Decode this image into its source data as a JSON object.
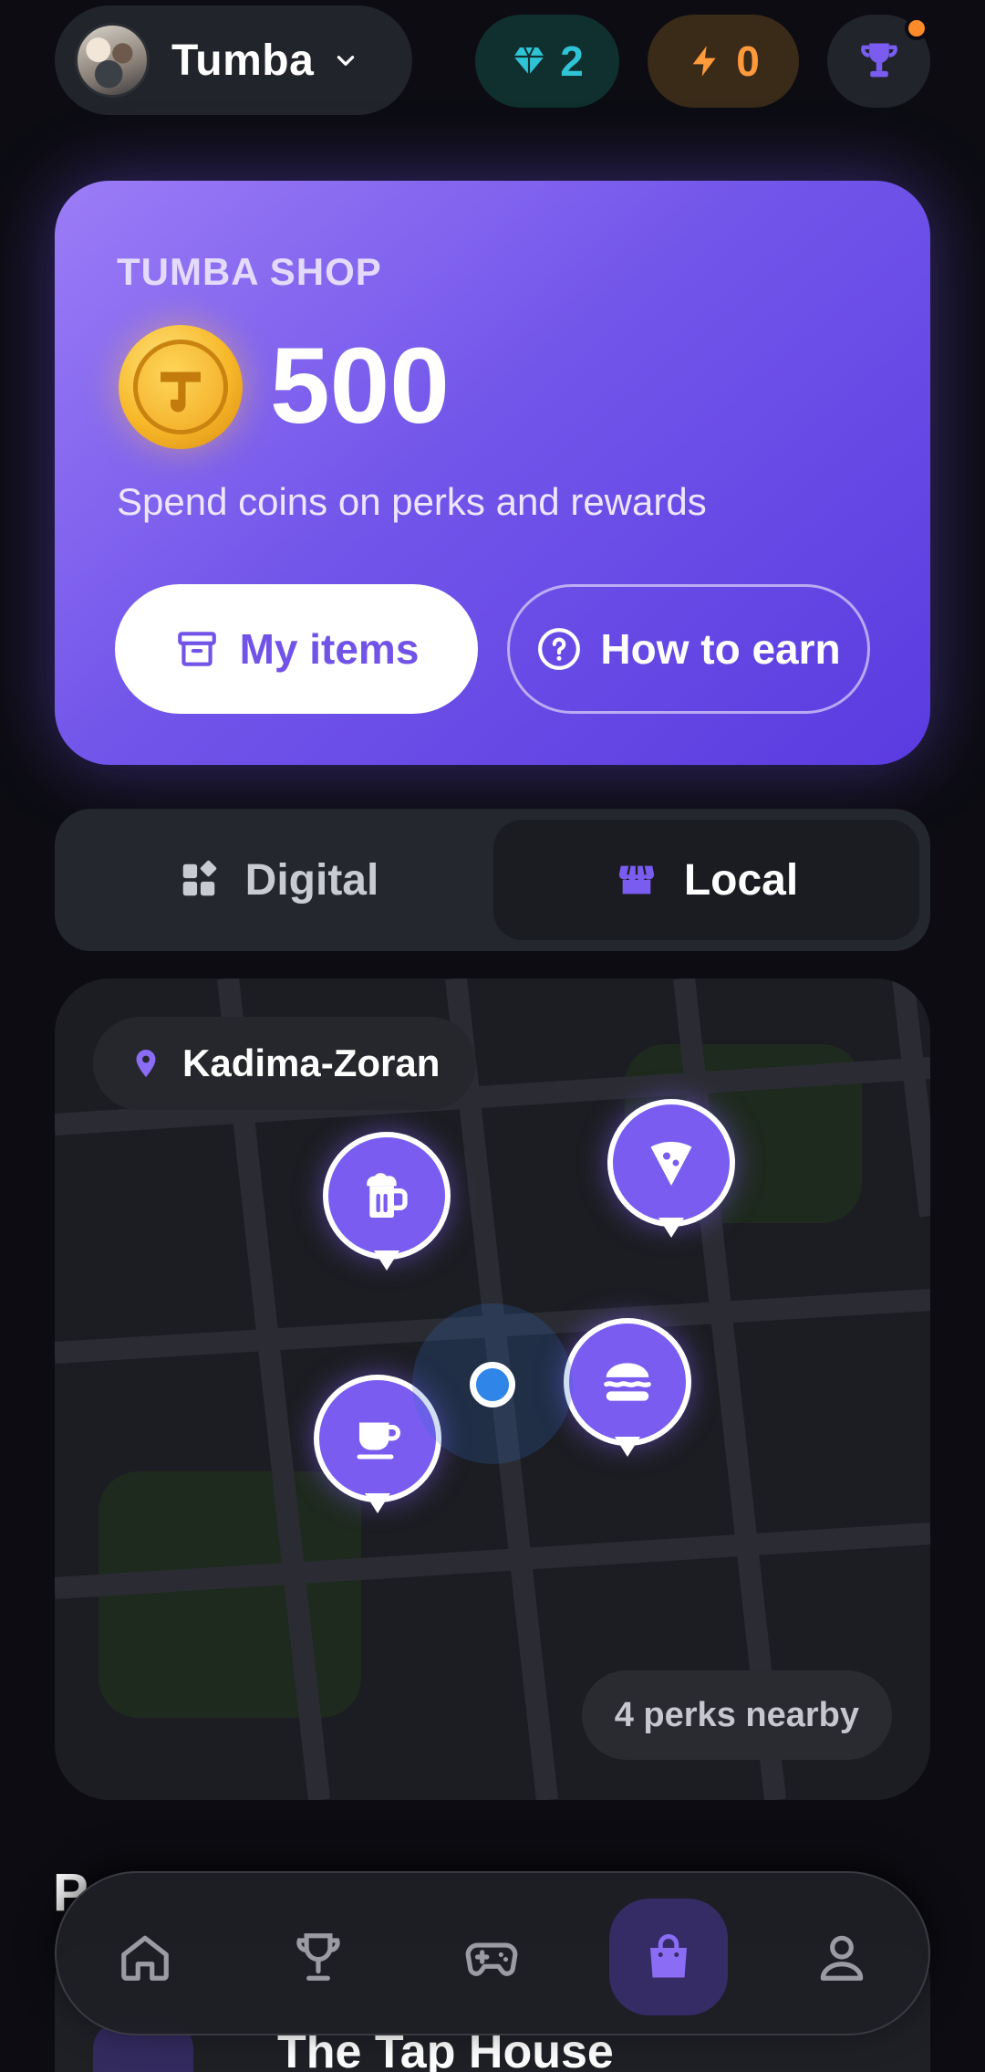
{
  "header": {
    "group_name": "Tumba",
    "gems": "2",
    "energy": "0"
  },
  "shop": {
    "label": "TUMBA SHOP",
    "balance": "500",
    "subtitle": "Spend coins on perks and rewards",
    "my_items_label": "My items",
    "how_to_earn_label": "How to earn"
  },
  "tabs": {
    "digital": "Digital",
    "local": "Local",
    "selected": "Local"
  },
  "map": {
    "location": "Kadima-Zoran",
    "perks_nearby": "4 perks nearby",
    "pins": [
      "beer-icon",
      "pizza-icon",
      "coffee-icon",
      "burger-icon"
    ]
  },
  "below": {
    "section_title_partial": "P",
    "card_title_partial": "The Tap House"
  },
  "nav": {
    "items": [
      "home-icon",
      "trophy-icon",
      "gamepad-icon",
      "shopping-bag-icon",
      "profile-icon"
    ],
    "active": "shopping-bag-icon"
  },
  "colors": {
    "accent": "#7a5cf0",
    "gem": "#2ec4d6",
    "energy": "#ff9a3c",
    "background": "#0c0c12"
  }
}
